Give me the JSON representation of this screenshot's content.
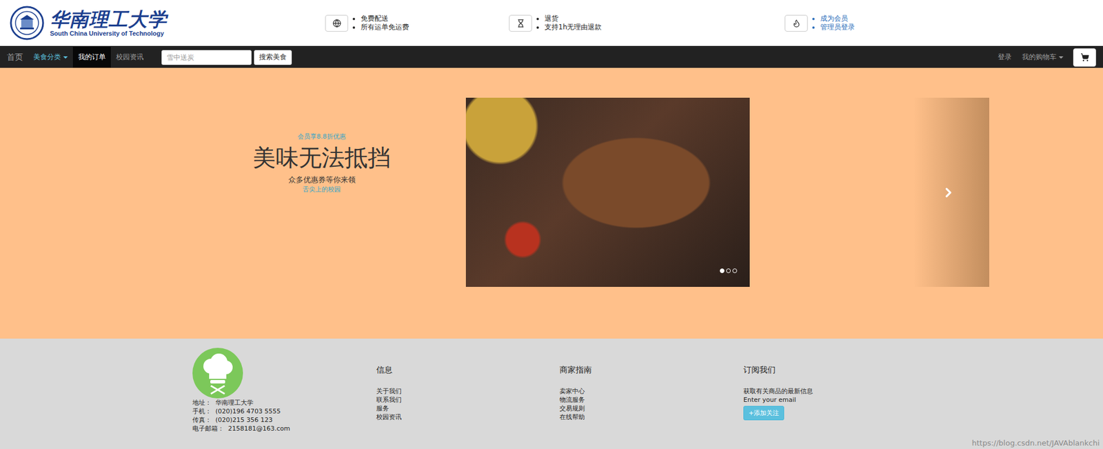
{
  "header": {
    "logo": {
      "chinese": "华南理工大学",
      "english": "South China University of Technology"
    },
    "features": [
      {
        "kind": "text",
        "icon": "globe",
        "lines": [
          "免费配送",
          "所有运单免运费"
        ]
      },
      {
        "kind": "text",
        "icon": "hourglass",
        "lines": [
          "退货",
          "支持1h无理由退款"
        ]
      },
      {
        "kind": "link",
        "icon": "fire",
        "lines": [
          "成为会员",
          "管理员登录"
        ]
      }
    ]
  },
  "navbar": {
    "items": [
      {
        "label": "首页",
        "selected": false,
        "highlighted": false,
        "dropdown": false
      },
      {
        "label": "美食分类",
        "selected": false,
        "highlighted": true,
        "dropdown": true
      },
      {
        "label": "我的订单",
        "selected": true,
        "highlighted": false,
        "dropdown": false
      },
      {
        "label": "校园资讯",
        "selected": false,
        "highlighted": false,
        "dropdown": false
      }
    ],
    "search": {
      "placeholder": "雪中送炭",
      "button": "搜索美食"
    },
    "right": [
      {
        "label": "登录",
        "dropdown": false
      },
      {
        "label": "我的购物车",
        "dropdown": true
      }
    ]
  },
  "hero": {
    "badge": "会员享8.8折优惠",
    "title": "美味无法抵挡",
    "subtitle": "众多优惠券等你来领",
    "link": "舌尖上的校园",
    "indicators": [
      {
        "selected": true
      },
      {
        "selected": false
      },
      {
        "selected": false
      }
    ]
  },
  "footer": {
    "contact": [
      "地址：  华南理工大学",
      "手机：  (020)196 4703 5555",
      "传真：  (020)215 356 123",
      "电子邮箱：  2158181@163.com"
    ],
    "columns": [
      {
        "title": "信息",
        "links": [
          "关于我们",
          "联系我们",
          "服务",
          "校园资讯"
        ]
      },
      {
        "title": "商家指南",
        "links": [
          "卖家中心",
          "物流服务",
          "交易规则",
          "在线帮助"
        ]
      }
    ],
    "subscribe": {
      "title": "订阅我们",
      "text": "获取有关商品的最新信息",
      "placeholder": "Enter your email",
      "button": "+添加关注"
    },
    "watermark": "https://blog.csdn.net/JAVAblankchi"
  }
}
